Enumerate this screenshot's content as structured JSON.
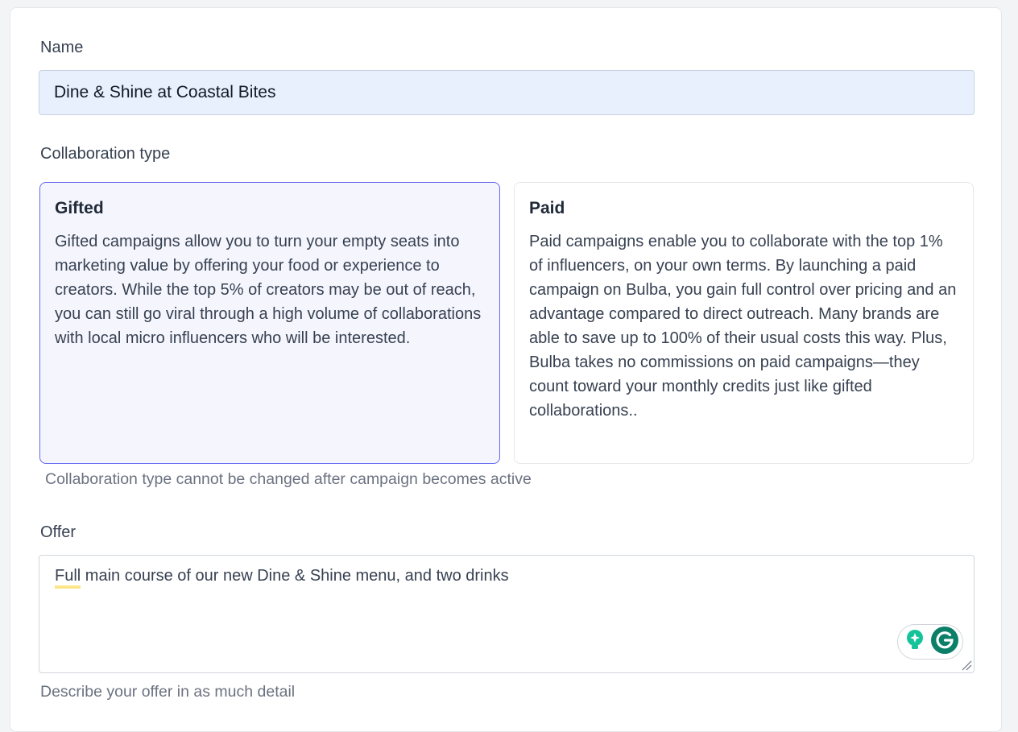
{
  "form": {
    "name": {
      "label": "Name",
      "value": "Dine & Shine at Coastal Bites"
    },
    "collaboration": {
      "label": "Collaboration type",
      "options": [
        {
          "title": "Gifted",
          "description": "Gifted campaigns allow you to turn your empty seats into marketing value by offering your food or experience to creators. While the top 5% of creators may be out of reach, you can still go viral through a high volume of collaborations with local micro influencers who will be interested.",
          "selected": true
        },
        {
          "title": "Paid",
          "description": "Paid campaigns enable you to collaborate with the top 1% of influencers, on your own terms. By launching a paid campaign on Bulba, you gain full control over pricing and an advantage compared to direct outreach. Many brands are able to save up to 100% of their usual costs this way. Plus, Bulba takes no commissions on paid campaigns—they count toward your monthly credits just like gifted collaborations..",
          "selected": false
        }
      ],
      "hint": "Collaboration type cannot be changed after campaign becomes active"
    },
    "offer": {
      "label": "Offer",
      "value_first_word": "Full",
      "value_rest": " main course of our new Dine & Shine menu, and two drinks",
      "hint": "Describe your offer in as much detail"
    }
  },
  "colors": {
    "accent": "#6366f1",
    "input_autofill": "#e8f0fe",
    "grammarly_green": "#15c39a",
    "grammarly_dark": "#0b7f68"
  },
  "icons": {
    "assistant": "lightbulb-icon",
    "grammarly": "grammarly-icon",
    "resize": "resize-handle-icon"
  }
}
